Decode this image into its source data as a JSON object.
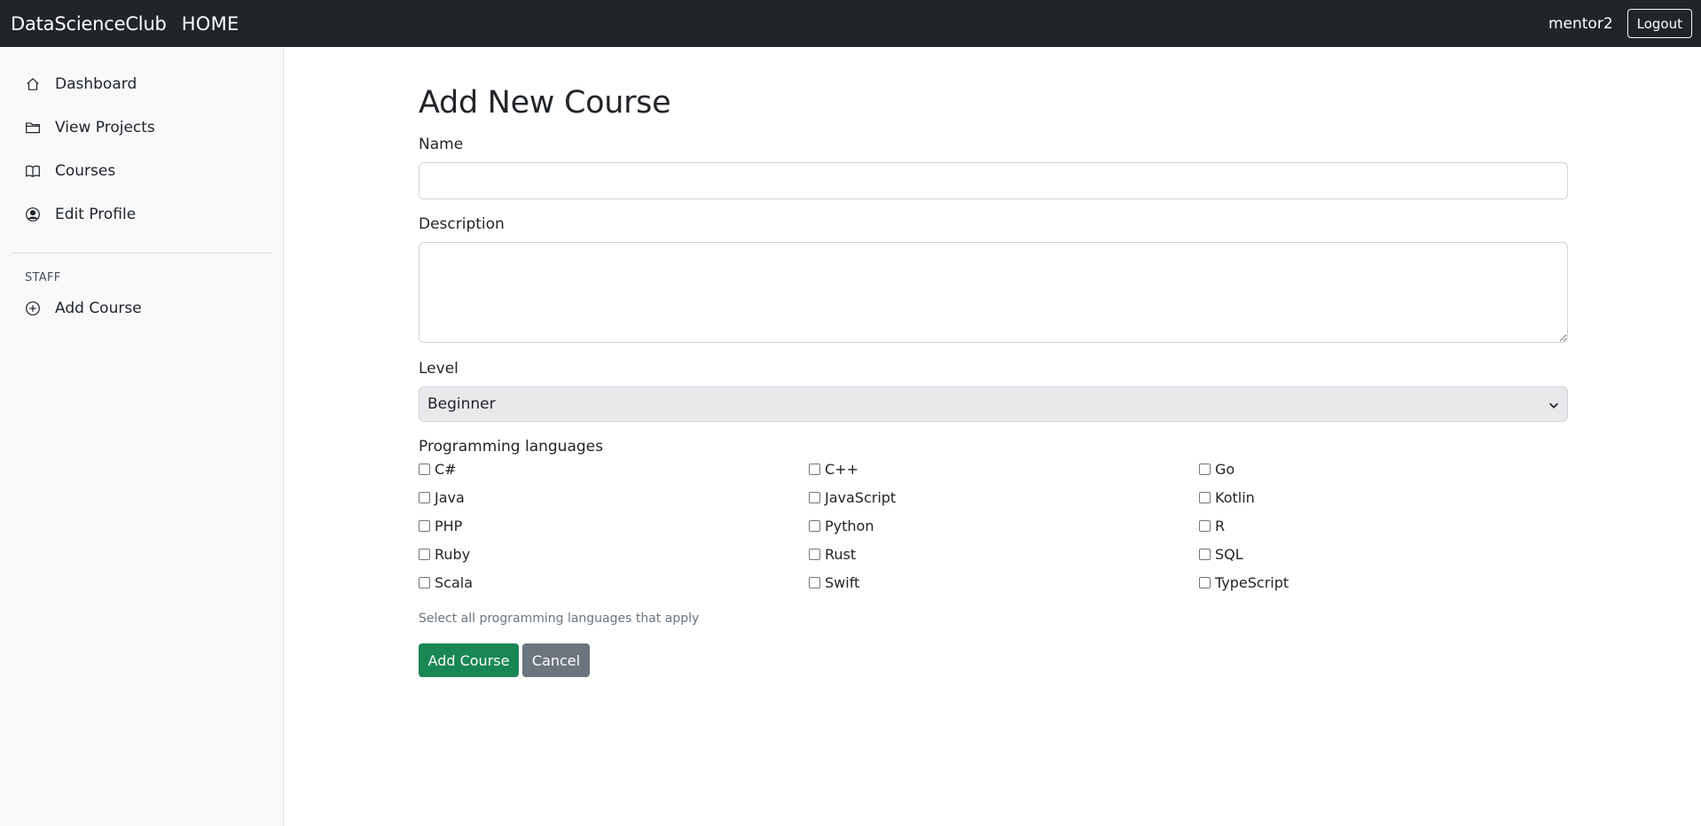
{
  "navbar": {
    "brand": "DataScienceClub",
    "home": "HOME",
    "username": "mentor2",
    "logout": "Logout"
  },
  "sidebar": {
    "items": [
      {
        "label": "Dashboard",
        "icon": "house-icon"
      },
      {
        "label": "View Projects",
        "icon": "folder-icon"
      },
      {
        "label": "Courses",
        "icon": "book-icon"
      },
      {
        "label": "Edit Profile",
        "icon": "person-circle-icon"
      }
    ],
    "staff_heading": "STAFF",
    "staff_items": [
      {
        "label": "Add Course",
        "icon": "plus-circle-icon"
      }
    ]
  },
  "form": {
    "title": "Add New Course",
    "name_label": "Name",
    "name_value": "",
    "description_label": "Description",
    "description_value": "",
    "level_label": "Level",
    "level_value": "Beginner",
    "languages_label": "Programming languages",
    "languages": [
      {
        "label": "C#",
        "checked": false
      },
      {
        "label": "C++",
        "checked": false
      },
      {
        "label": "Go",
        "checked": false
      },
      {
        "label": "Java",
        "checked": false
      },
      {
        "label": "JavaScript",
        "checked": false
      },
      {
        "label": "Kotlin",
        "checked": false
      },
      {
        "label": "PHP",
        "checked": false
      },
      {
        "label": "Python",
        "checked": false
      },
      {
        "label": "R",
        "checked": false
      },
      {
        "label": "Ruby",
        "checked": false
      },
      {
        "label": "Rust",
        "checked": false
      },
      {
        "label": "SQL",
        "checked": false
      },
      {
        "label": "Scala",
        "checked": false
      },
      {
        "label": "Swift",
        "checked": false
      },
      {
        "label": "TypeScript",
        "checked": false
      }
    ],
    "help_text": "Select all programming languages that apply",
    "submit_label": "Add Course",
    "cancel_label": "Cancel"
  },
  "colors": {
    "navbar_bg": "#212529",
    "sidebar_bg": "#f8f9fa",
    "primary": "#198754",
    "secondary": "#6c757d"
  }
}
